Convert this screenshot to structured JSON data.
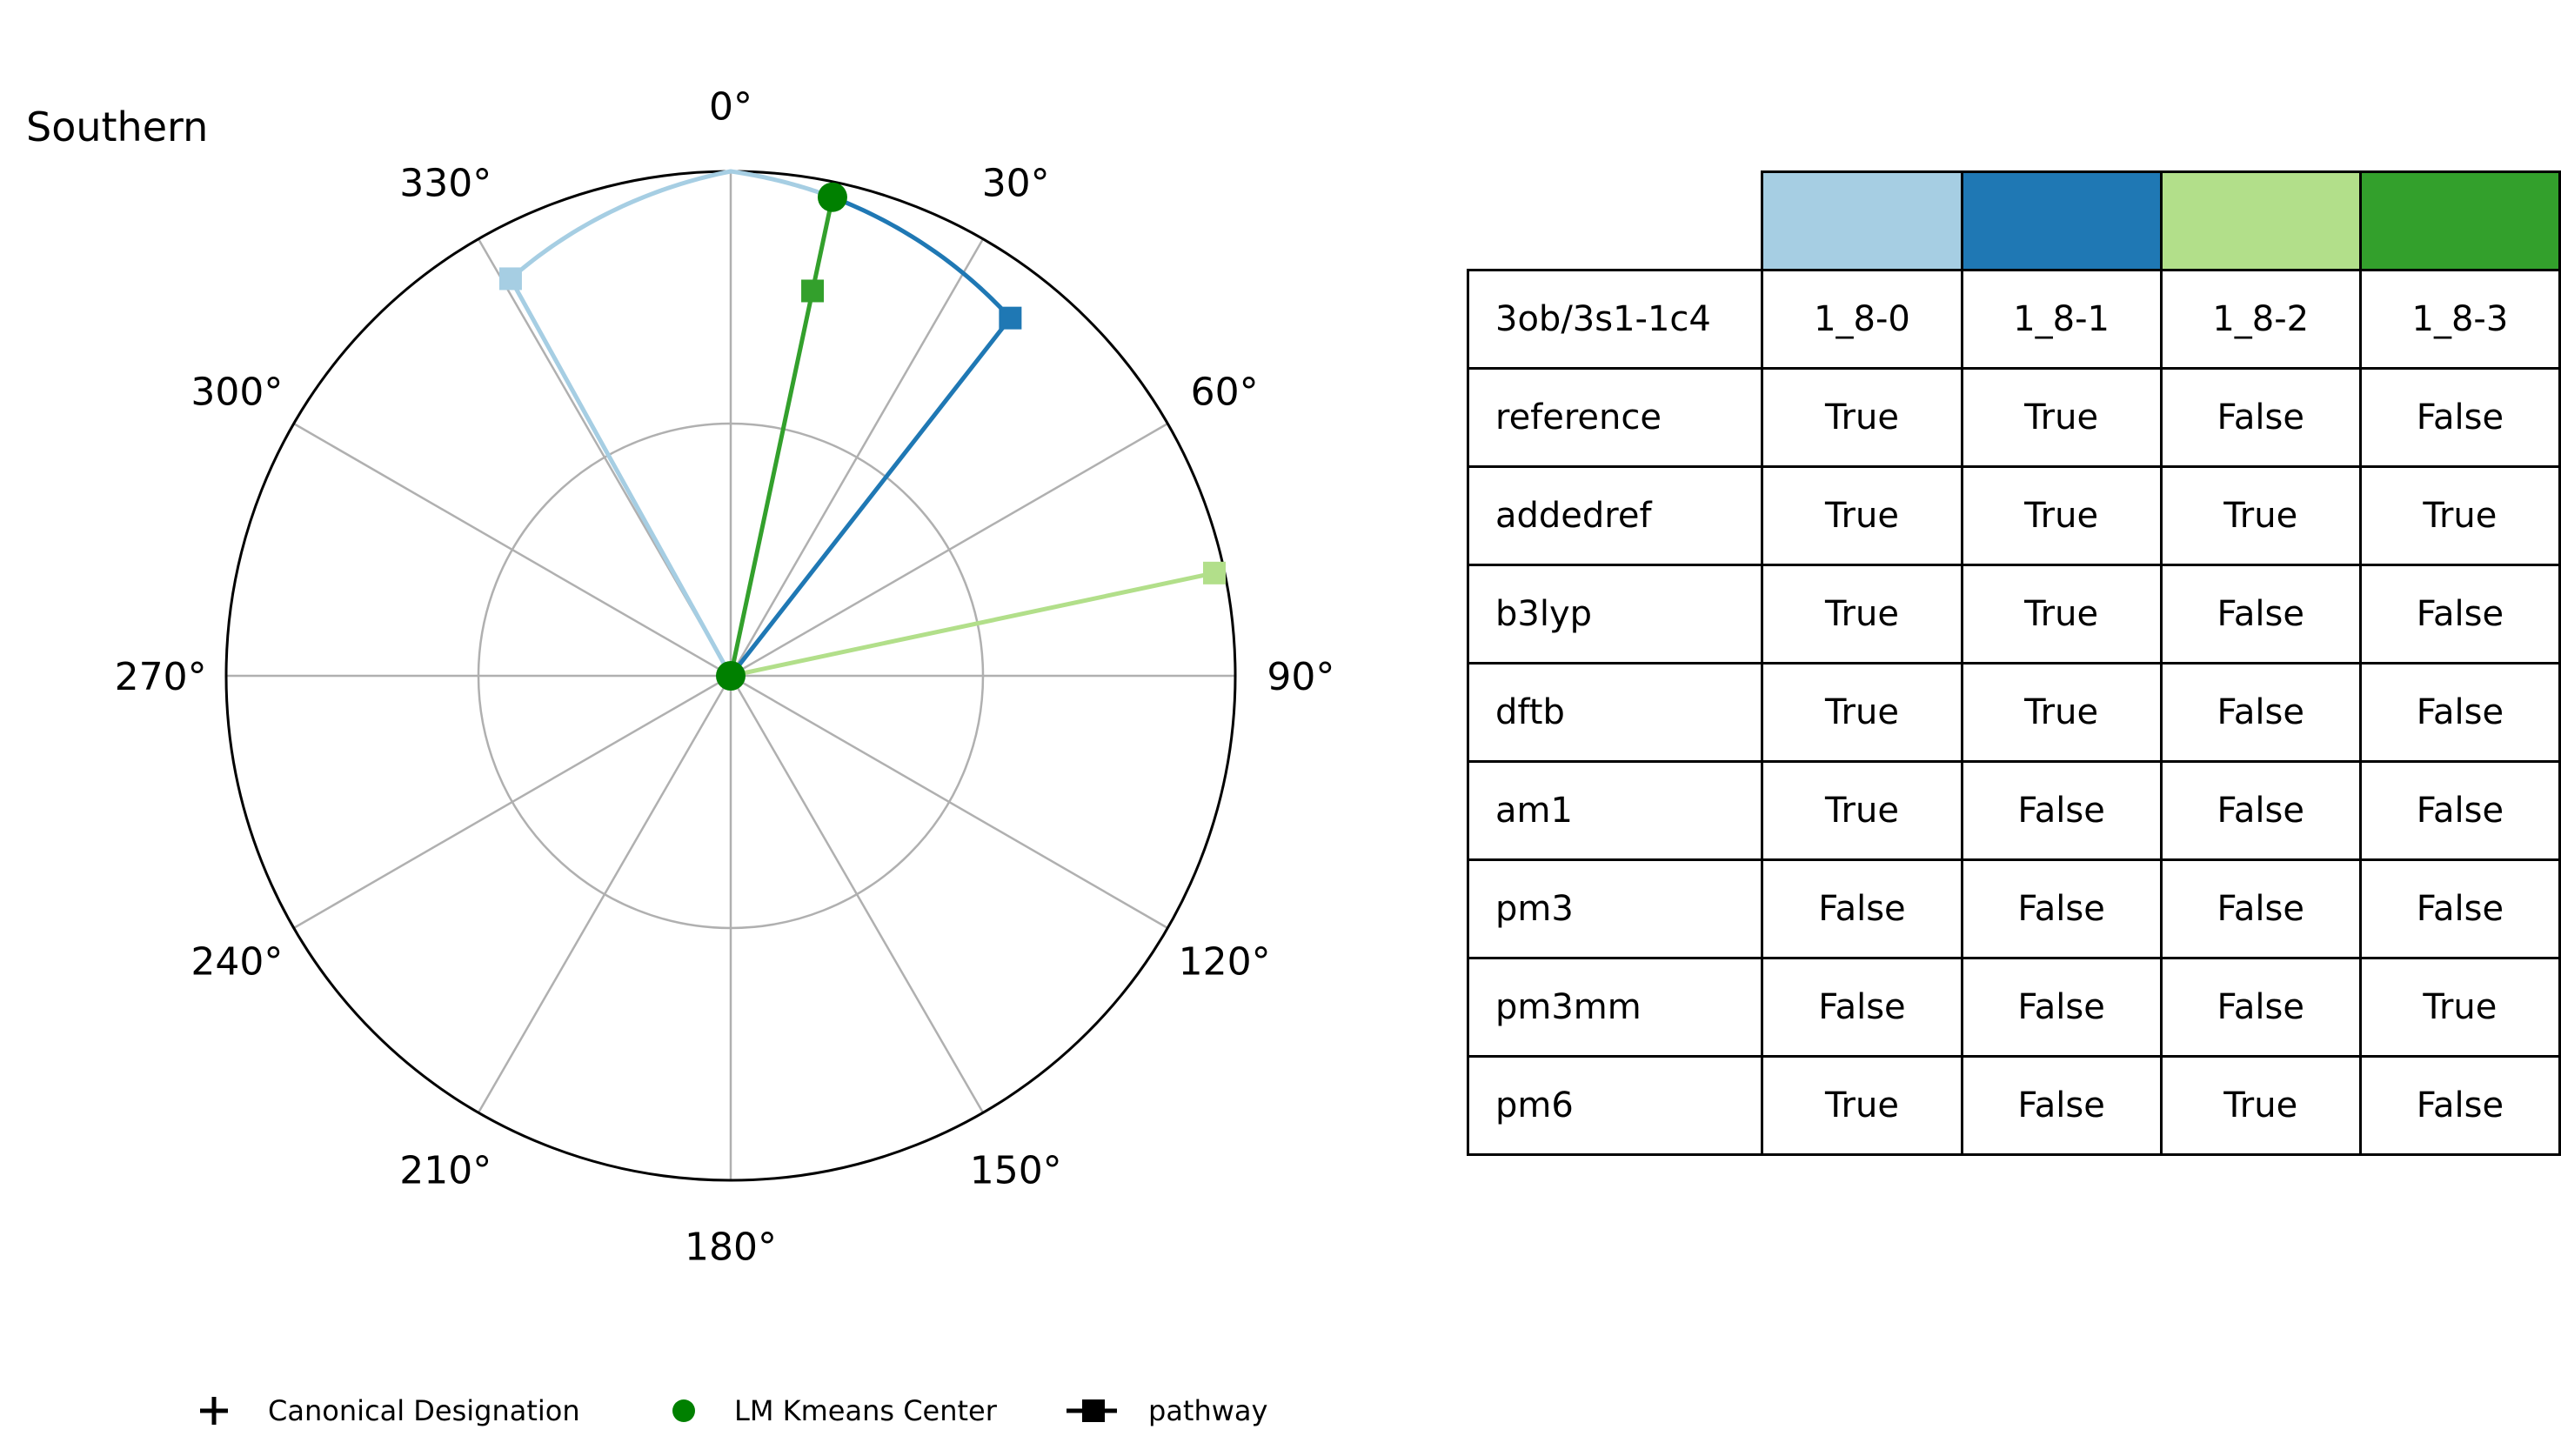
{
  "chart_data": {
    "type": "polar",
    "title": "Southern",
    "theta_direction": "clockwise",
    "theta_zero": "top",
    "theta_ticks": [
      "0°",
      "30°",
      "60°",
      "90°",
      "120°",
      "150°",
      "180°",
      "210°",
      "240°",
      "270°",
      "300°",
      "330°"
    ],
    "rlim": [
      0,
      1
    ],
    "grid": true,
    "center_point": {
      "theta": 0,
      "r": 0
    },
    "series": [
      {
        "color": "#a6cee3",
        "points": [
          {
            "theta": 0,
            "r": 0
          },
          {
            "theta": 331,
            "r": 0.9
          },
          {
            "theta": 0,
            "r": 1.0
          },
          {
            "theta": 12,
            "r": 0.97
          }
        ],
        "end_point": {
          "theta": 0,
          "r": 0
        }
      },
      {
        "color": "#1f78b4",
        "points": [
          {
            "theta": 0,
            "r": 0
          },
          {
            "theta": 38,
            "r": 0.9
          },
          {
            "theta": 12,
            "r": 0.97
          }
        ],
        "end_point": {
          "theta": 0,
          "r": 0
        }
      },
      {
        "color": "#b2df8a",
        "points": [
          {
            "theta": 0,
            "r": 0
          },
          {
            "theta": 78,
            "r": 0.98
          }
        ],
        "end_point": {
          "theta": 0,
          "r": 0
        }
      },
      {
        "color": "#33a02c",
        "points": [
          {
            "theta": 0,
            "r": 0
          },
          {
            "theta": 12,
            "r": 0.78
          },
          {
            "theta": 12,
            "r": 0.97
          }
        ],
        "end_point": {
          "theta": 0,
          "r": 0
        }
      }
    ],
    "kmeans_centers": [
      {
        "theta": 12,
        "r": 0.97,
        "color": "#008000"
      },
      {
        "theta": 0,
        "r": 0,
        "color": "#008000"
      }
    ],
    "legend": {
      "placement": "bottom",
      "entries": [
        {
          "label": "Canonical Designation",
          "marker": "plus",
          "color": "#000000"
        },
        {
          "label": "LM Kmeans Center",
          "marker": "circle",
          "color": "#008000"
        },
        {
          "label": "pathway",
          "marker": "line-square",
          "color": "#000000"
        }
      ]
    }
  },
  "table": {
    "header_colors": [
      "#a6cee3",
      "#1f78b4",
      "#b2df8a",
      "#33a02c"
    ],
    "rows": [
      {
        "name": "3ob/3s1-1c4",
        "values": [
          "1_8-0",
          "1_8-1",
          "1_8-2",
          "1_8-3"
        ]
      },
      {
        "name": "reference",
        "values": [
          "True",
          "True",
          "False",
          "False"
        ]
      },
      {
        "name": "addedref",
        "values": [
          "True",
          "True",
          "True",
          "True"
        ]
      },
      {
        "name": "b3lyp",
        "values": [
          "True",
          "True",
          "False",
          "False"
        ]
      },
      {
        "name": "dftb",
        "values": [
          "True",
          "True",
          "False",
          "False"
        ]
      },
      {
        "name": "am1",
        "values": [
          "True",
          "False",
          "False",
          "False"
        ]
      },
      {
        "name": "pm3",
        "values": [
          "False",
          "False",
          "False",
          "False"
        ]
      },
      {
        "name": "pm3mm",
        "values": [
          "False",
          "False",
          "False",
          "True"
        ]
      },
      {
        "name": "pm6",
        "values": [
          "True",
          "False",
          "True",
          "False"
        ]
      }
    ]
  }
}
